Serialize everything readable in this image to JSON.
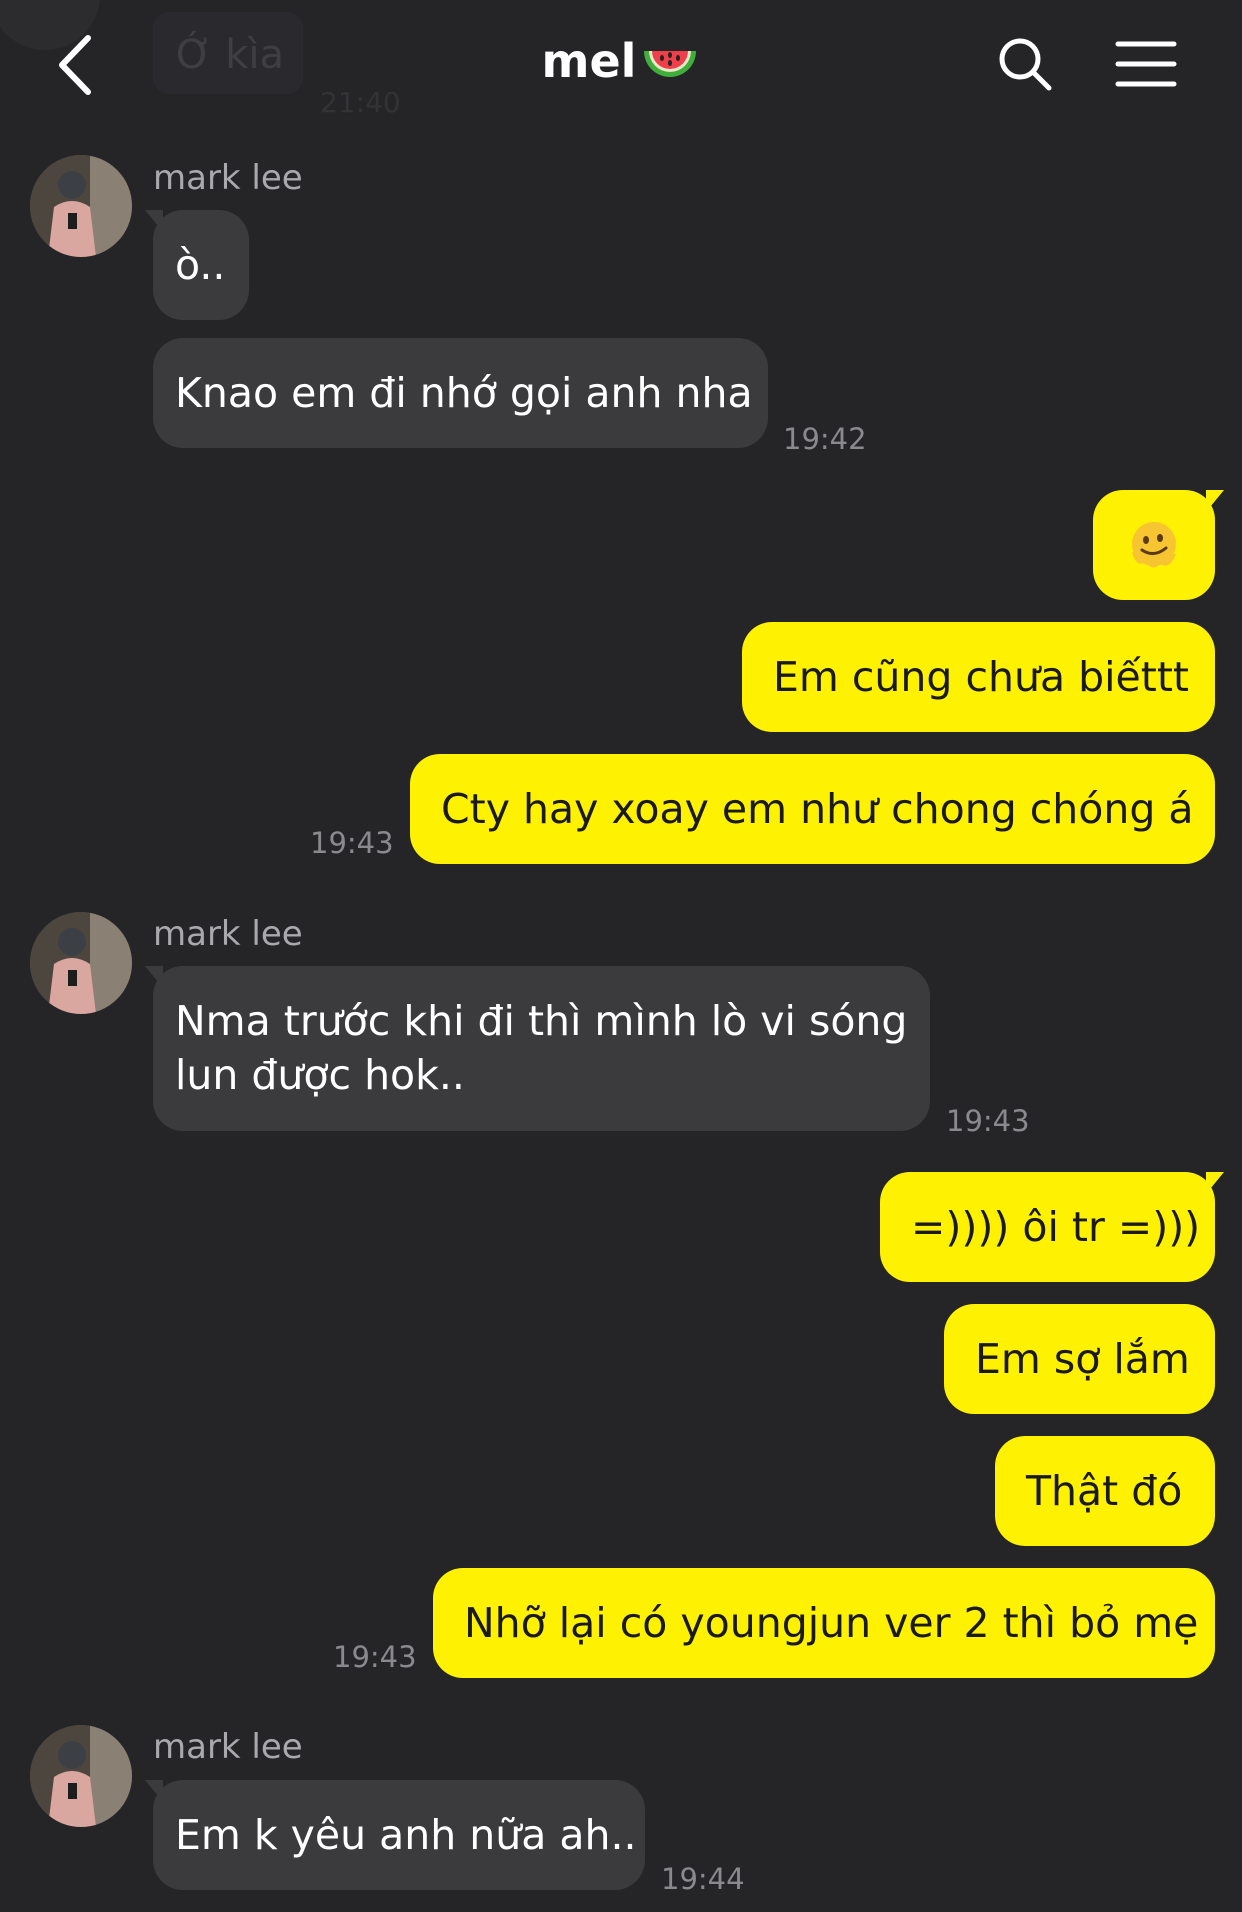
{
  "header": {
    "title": "mel",
    "title_emoji": "watermelon",
    "back_icon": "chevron-left-icon",
    "search_icon": "search-icon",
    "menu_icon": "hamburger-menu-icon",
    "ghost_message": "Ớ kìa",
    "ghost_time": "21:40"
  },
  "colors": {
    "background": "#252528",
    "incoming_bubble": "#3b3b3e",
    "outgoing_bubble": "#fef102",
    "timestamp": "#8a8a8e",
    "sender_name": "#a9a9ad"
  },
  "messages": {
    "g1": {
      "sender": "mark lee",
      "m1": "ò..",
      "m2": "Knao em đi nhớ gọi anh nha",
      "time": "19:42"
    },
    "g2": {
      "m1_emoji": "melting-face",
      "m2": "Em cũng chưa biếttt",
      "m3": "Cty hay xoay em như chong chóng á",
      "time": "19:43"
    },
    "g3": {
      "sender": "mark lee",
      "m1_line1": "Nma trước khi đi thì mình lò vi sóng",
      "m1_line2": "lun được hok..",
      "time": "19:43"
    },
    "g4": {
      "m1": "=)))) ôi tr =)))",
      "m2": "Em sợ lắm",
      "m3": "Thật đó",
      "m4": "Nhỡ lại có youngjun ver 2 thì bỏ mẹ",
      "time": "19:43"
    },
    "g5": {
      "sender": "mark lee",
      "m1": "Em k yêu anh nữa ah..",
      "time": "19:44"
    }
  }
}
